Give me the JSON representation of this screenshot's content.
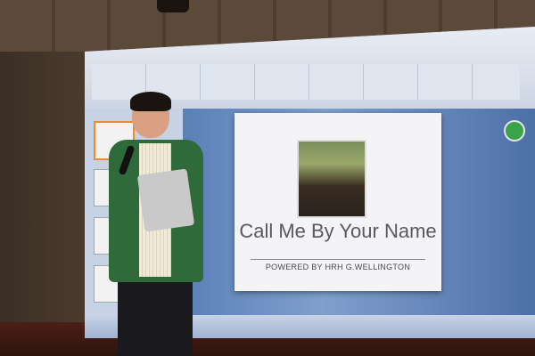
{
  "slide": {
    "title": "Call Me By Your Name",
    "subtitle": "POWERED BY HRH G.WELLINGTON"
  },
  "colors": {
    "slide_background": "#f4f4f6",
    "slide_area_blue": "#6b8fc4",
    "jacket_green": "#2f6a3a",
    "stage_red": "#4b1f16"
  },
  "icons": {
    "status_badge": "green-circle-icon"
  }
}
